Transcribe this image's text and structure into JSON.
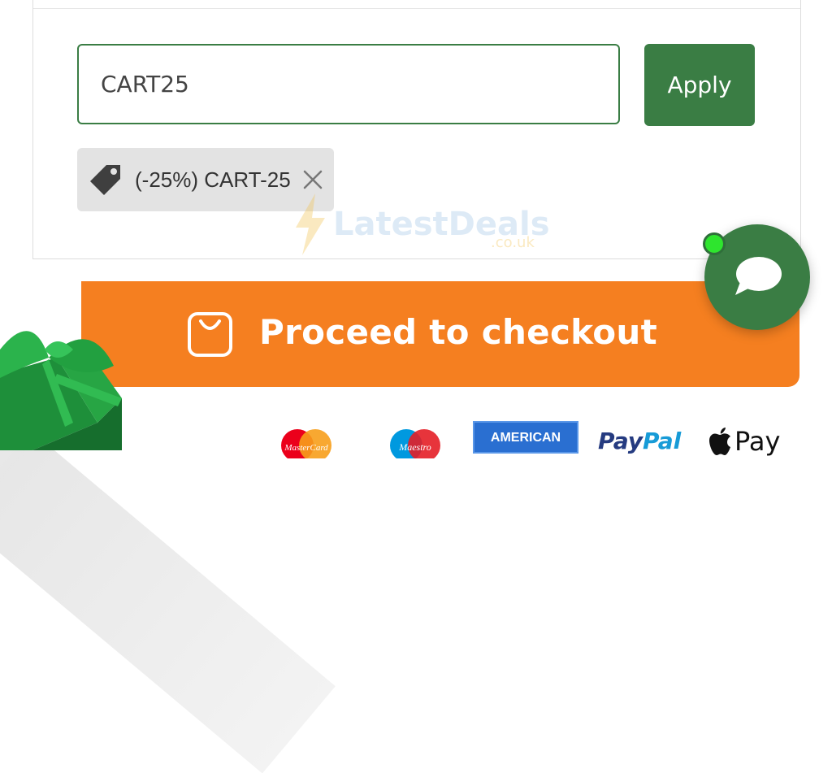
{
  "coupon": {
    "input_value": "CART25",
    "apply_label": "Apply"
  },
  "applied_coupon": {
    "label": "(-25%) CART-25"
  },
  "watermark": {
    "name": "LatestDeals",
    "domain": ".co.uk"
  },
  "checkout": {
    "label": "Proceed to checkout"
  },
  "payment_methods": {
    "mastercard": "MasterCard",
    "maestro": "Maestro",
    "amex": "AMERICAN",
    "paypal_pay": "Pay",
    "paypal_pal": "Pal",
    "applepay": "Pay"
  },
  "colors": {
    "brand_green": "#3a7d44",
    "checkout_orange": "#f57f20",
    "online_green": "#2ee52e"
  },
  "icons": [
    "tag-icon",
    "close-icon",
    "shopping-bag-icon",
    "chat-bubble-icon",
    "apple-icon"
  ]
}
